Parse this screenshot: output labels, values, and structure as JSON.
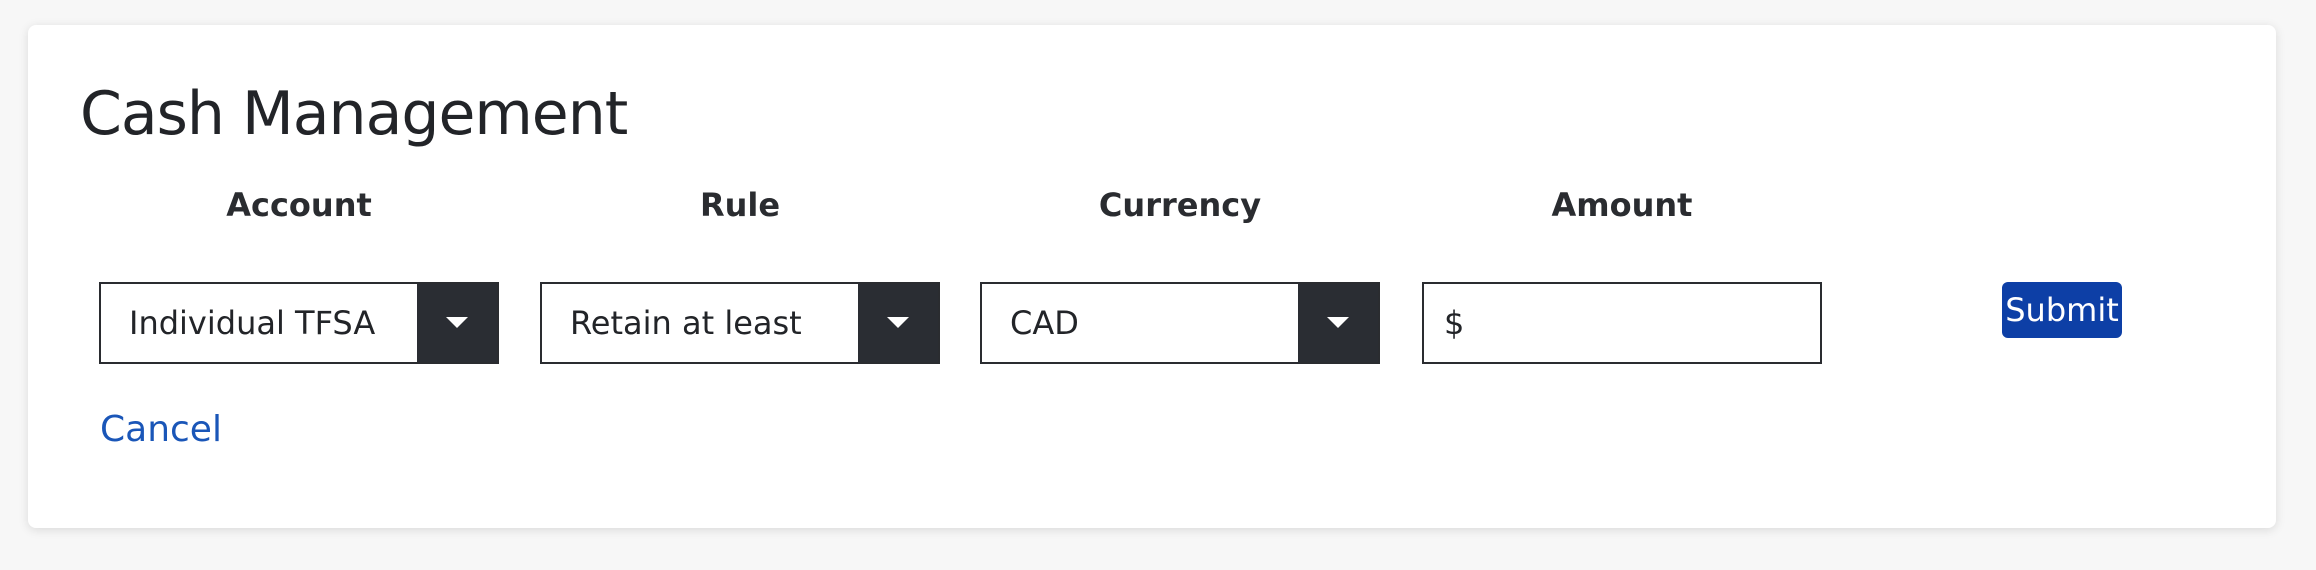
{
  "form": {
    "title": "Cash Management",
    "labels": {
      "account": "Account",
      "rule": "Rule",
      "currency": "Currency",
      "amount": "Amount"
    },
    "account_select": {
      "value": "Individual TFSA",
      "icon": "caret-down-icon"
    },
    "rule_select": {
      "value": "Retain at least",
      "icon": "caret-down-icon"
    },
    "currency_select": {
      "value": "CAD",
      "icon": "caret-down-icon"
    },
    "amount_input": {
      "prefix": "$",
      "value": ""
    },
    "submit_label": "Submit",
    "cancel_label": "Cancel"
  },
  "colors": {
    "primary_button": "#0d3fa6",
    "link": "#1a56b8",
    "select_arrow_bg": "#2a2d33",
    "text": "#222428"
  }
}
